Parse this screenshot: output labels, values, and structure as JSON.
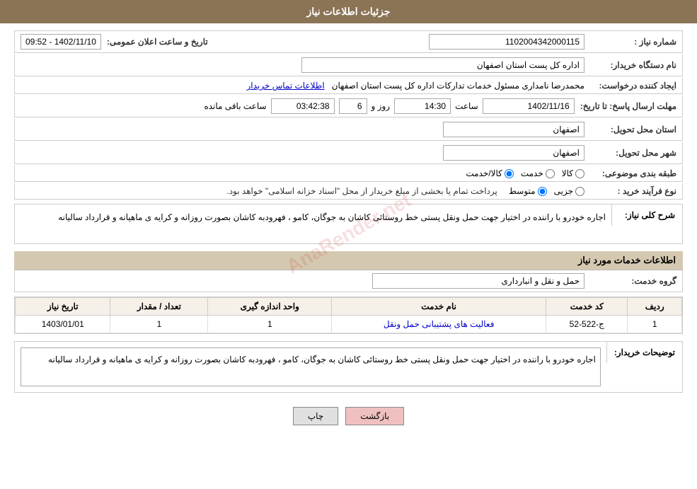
{
  "header": {
    "title": "جزئیات اطلاعات نیاز"
  },
  "fields": {
    "need_number_label": "شماره نیاز :",
    "need_number_value": "1102004342000115",
    "date_label": "تاریخ و ساعت اعلان عمومی:",
    "date_value": "1402/11/10 - 09:52",
    "org_label": "نام دستگاه خریدار:",
    "org_value": "اداره کل پست استان اصفهان",
    "creator_label": "ایجاد کننده درخواست:",
    "creator_value": "محمدرضا نامداری مسئول خدمات تدارکات اداره کل پست استان اصفهان",
    "creator_link": "اطلاعات تماس خریدار",
    "deadline_label": "مهلت ارسال پاسخ: تا تاریخ:",
    "deadline_date": "1402/11/16",
    "deadline_time_label": "ساعت",
    "deadline_time": "14:30",
    "deadline_day_label": "روز و",
    "deadline_days": "6",
    "deadline_remaining_label": "ساعت باقی مانده",
    "deadline_remaining": "03:42:38",
    "province_label": "استان محل تحویل:",
    "province_value": "اصفهان",
    "city_label": "شهر محل تحویل:",
    "city_value": "اصفهان",
    "category_label": "طبقه بندی موضوعی:",
    "category_options": [
      "کالا",
      "خدمت",
      "کالا/خدمت"
    ],
    "category_selected": "کالا/خدمت",
    "process_label": "نوع فرآیند خرید :",
    "process_options": [
      "جزیی",
      "متوسط"
    ],
    "process_note": "پرداخت تمام یا بخشی از مبلغ خریدار از محل \"اسناد خزانه اسلامی\" خواهد بود.",
    "description_label": "شرح کلی نیاز:",
    "description_text": "اجاره خودرو با راننده در اختیار جهت حمل ونقل پستی خط روستائی کاشان به جوگان، کامو ، فهرودبه کاشان بصورت روزانه و کرایه ی ماهیانه و قرارداد سالیانه"
  },
  "services_section": {
    "title": "اطلاعات خدمات مورد نیاز",
    "service_group_label": "گروه خدمت:",
    "service_group_value": "حمل و نقل و انبارداری",
    "table": {
      "headers": [
        "ردیف",
        "کد خدمت",
        "نام خدمت",
        "واحد اندازه گیری",
        "تعداد / مقدار",
        "تاریخ نیاز"
      ],
      "rows": [
        {
          "row": "1",
          "code": "ج-522-52",
          "name": "فعالیت های پشتیبانی حمل ونقل",
          "unit": "1",
          "quantity": "1",
          "date": "1403/01/01"
        }
      ]
    }
  },
  "buyer_description": {
    "label": "توضیحات خریدار:",
    "text": "اجاره خودرو با راننده در اختیار جهت حمل ونقل پستی خط روستائی کاشان به جوگان، کامو ، فهرودبه کاشان بصورت روزانه و کرایه ی ماهیانه و قرارداد سالیانه"
  },
  "buttons": {
    "print": "چاپ",
    "back": "بازگشت"
  }
}
